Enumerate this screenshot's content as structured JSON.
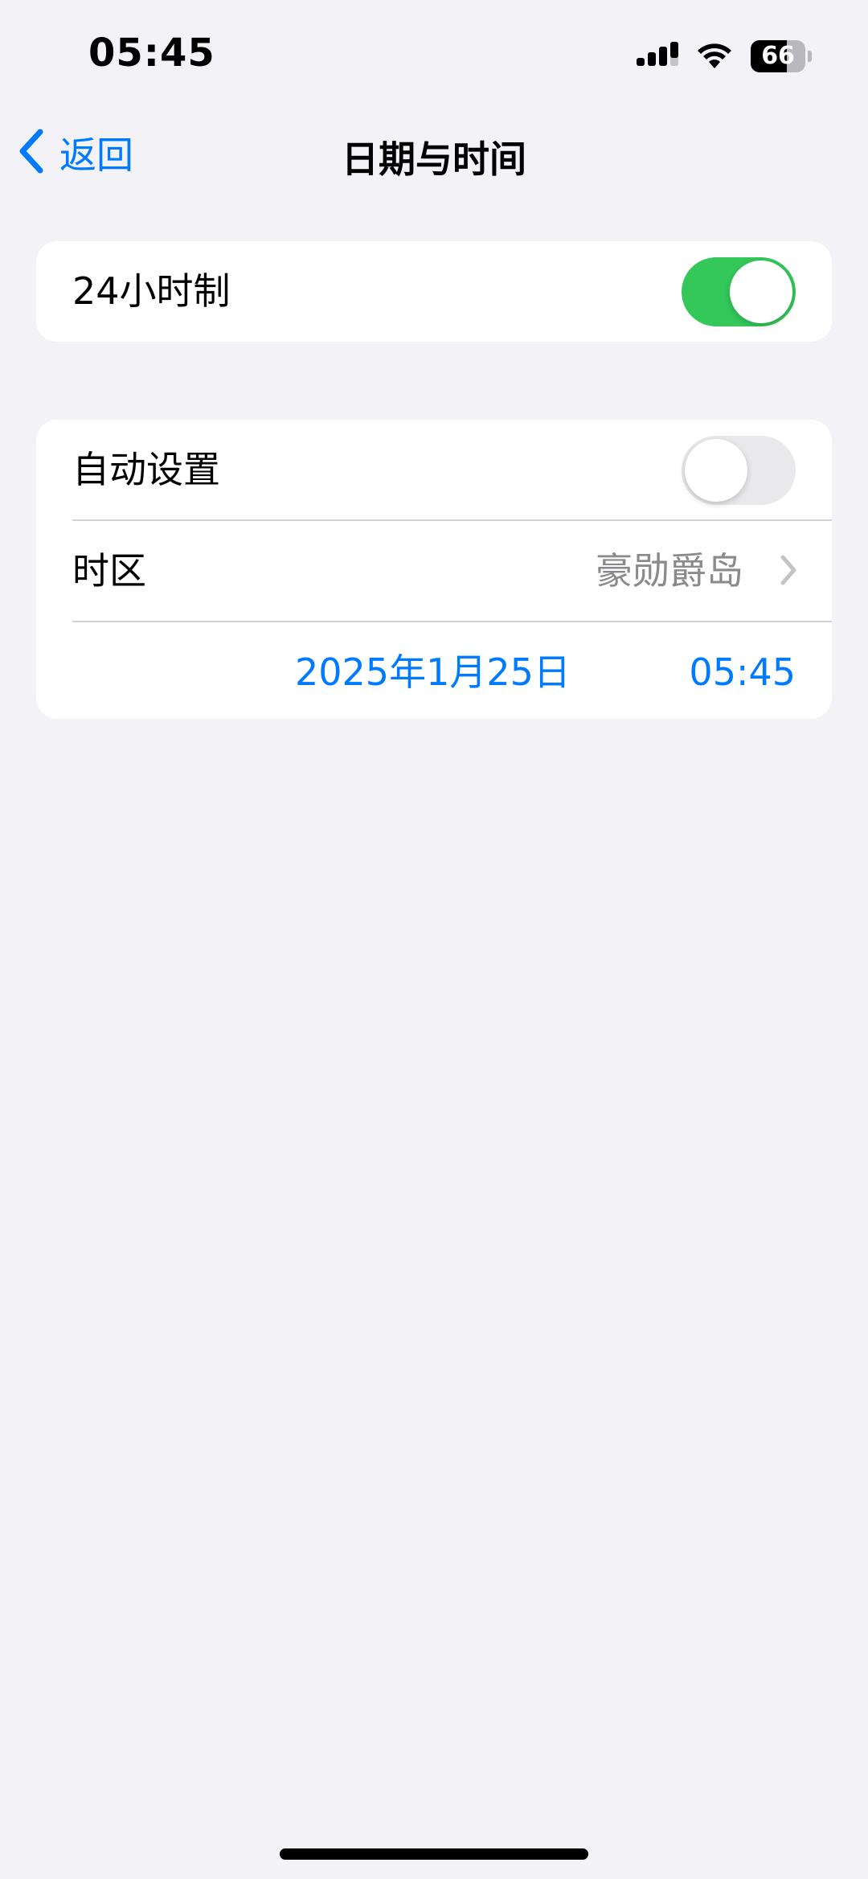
{
  "status_bar": {
    "time": "05:45",
    "battery_level": "66",
    "signal_icon": "cellular-signal-icon",
    "wifi_icon": "wifi-icon"
  },
  "nav": {
    "back_label": "返回",
    "back_icon": "chevron-left-icon",
    "title": "日期与时间"
  },
  "settings": {
    "hour24": {
      "label": "24小时制",
      "enabled": true
    },
    "auto_set": {
      "label": "自动设置",
      "enabled": false
    },
    "timezone": {
      "label": "时区",
      "value": "豪勋爵岛"
    },
    "date": "2025年1月25日",
    "time": "05:45"
  },
  "colors": {
    "accent": "#007aff",
    "toggle_on": "#34c759",
    "background": "#f2f2f7"
  }
}
